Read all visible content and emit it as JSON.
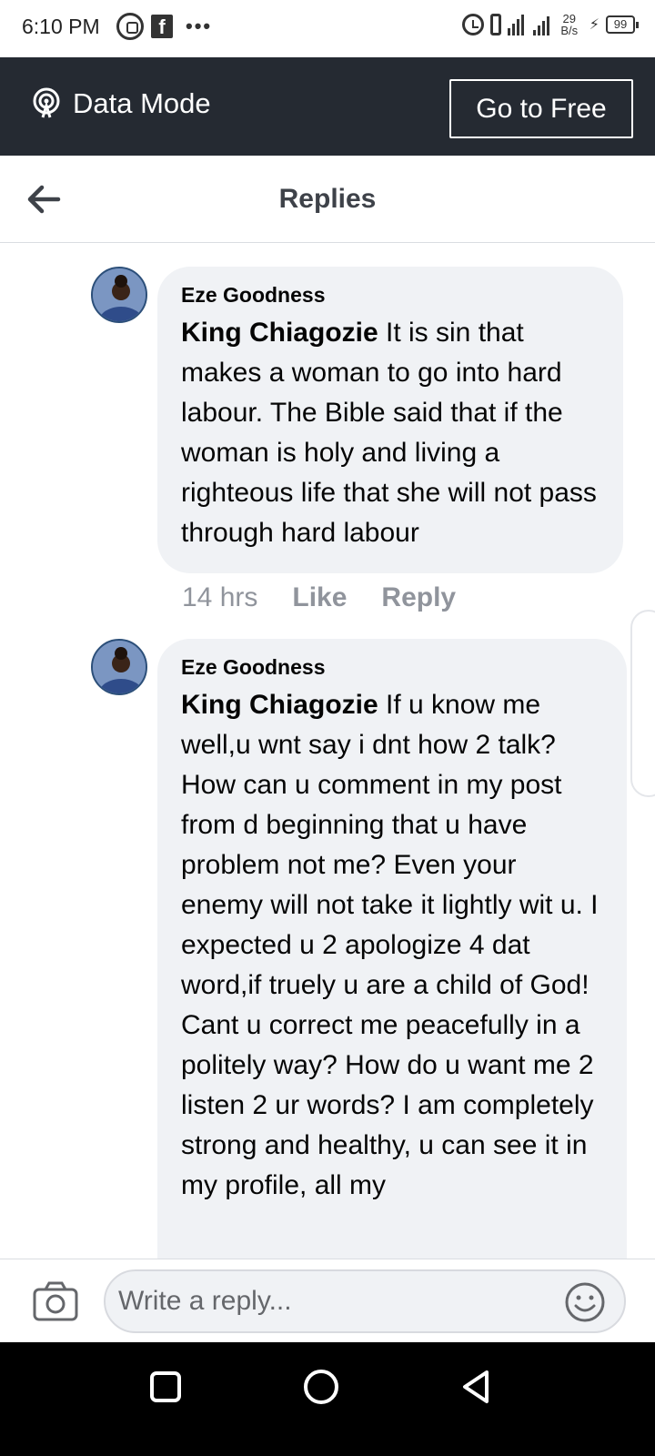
{
  "status_bar": {
    "time": "6:10 PM",
    "net_speed_value": "29",
    "net_speed_unit": "B/s",
    "battery": "99",
    "icons": [
      "whatsapp-icon",
      "facebook-icon",
      "more-dots-icon",
      "alarm-icon",
      "vibrate-icon",
      "signal-icon",
      "charging-icon",
      "battery-icon"
    ]
  },
  "banner": {
    "label": "Data Mode",
    "button": "Go to Free",
    "background": "#252a32"
  },
  "header": {
    "title": "Replies"
  },
  "comments": [
    {
      "author": "Eze Goodness",
      "mention": "King Chiagozie",
      "text": " It is sin that makes a woman to go into hard labour. The Bible said that if the woman is holy and living a righteous life that she will not pass through hard labour",
      "time": "14 hrs",
      "like": "Like",
      "reply": "Reply"
    },
    {
      "author": "Eze Goodness",
      "mention": "King Chiagozie",
      "text": " If u know me well,u wnt say i dnt how 2 talk? How can u comment in my post from d beginning that u have problem not me? Even your enemy will not take it lightly wit u. I expected u 2 apologize 4 dat word,if truely u are a child of God! Cant u correct me peacefully in a politely way? How do u want me 2 listen 2 ur words? I am completely strong and healthy, u can see it in my profile, all my"
    }
  ],
  "reply_bar": {
    "placeholder": "Write a reply..."
  },
  "colors": {
    "bubble": "#f0f2f5",
    "meta_text": "#90949c",
    "nav_bar": "#000000"
  }
}
